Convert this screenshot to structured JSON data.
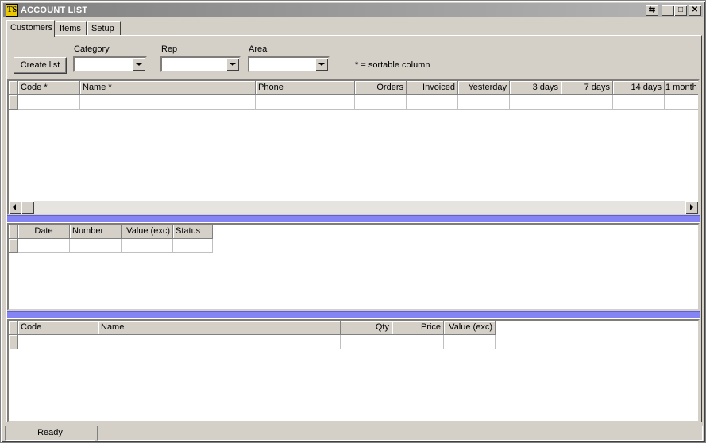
{
  "window": {
    "title": "ACCOUNT LIST",
    "icon_text": "TS",
    "controls": {
      "restore": "⇆",
      "minimize": "_",
      "maximize": "□",
      "close": "✕"
    }
  },
  "tabs": [
    {
      "label": "Customers",
      "active": true
    },
    {
      "label": "Items",
      "active": false
    },
    {
      "label": "Setup",
      "active": false
    }
  ],
  "filters": {
    "create_button": "Create list",
    "category_label": "Category",
    "category_value": "",
    "rep_label": "Rep",
    "rep_value": "",
    "area_label": "Area",
    "area_value": "",
    "sortable_note": "* = sortable column"
  },
  "customers_grid": {
    "columns": [
      "Code *",
      "Name *",
      "Phone",
      "Orders",
      "Invoiced",
      "Yesterday",
      "3 days",
      "7 days",
      "14 days",
      "1 month"
    ]
  },
  "orders_grid": {
    "columns": [
      "Date",
      "Number",
      "Value (exc)",
      "Status"
    ]
  },
  "items_grid": {
    "columns": [
      "Code",
      "Name",
      "Qty",
      "Price",
      "Value (exc)"
    ]
  },
  "status": {
    "text": "Ready"
  },
  "colors": {
    "splitter": "#8484f4",
    "face": "#d4d0c8",
    "title_gradient_start": "#808080"
  }
}
